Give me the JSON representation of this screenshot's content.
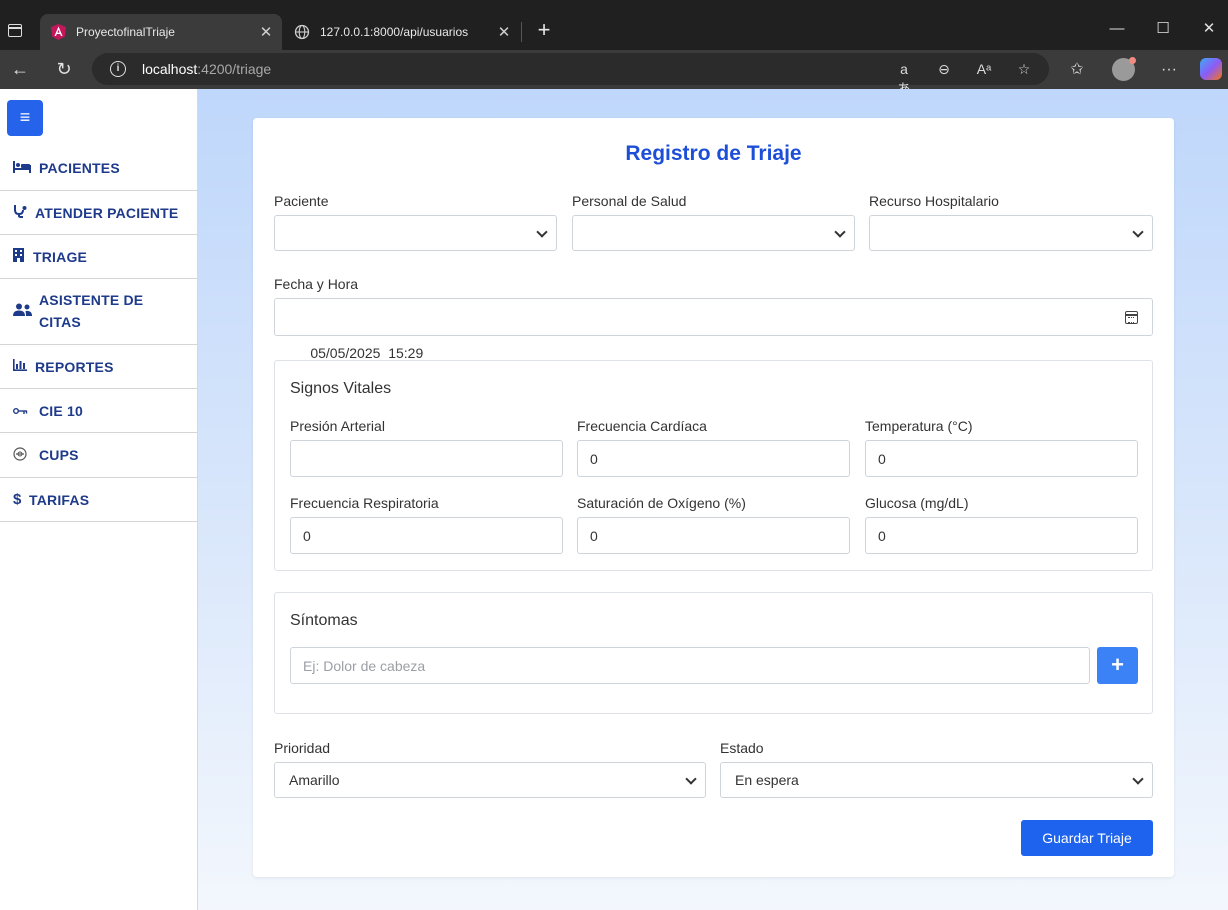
{
  "browser": {
    "tabs": [
      {
        "title": "ProyectofinalTriaje",
        "active": true
      },
      {
        "title": "127.0.0.1:8000/api/usuarios",
        "active": false
      }
    ],
    "url_host": "localhost",
    "url_rest": ":4200/triage"
  },
  "sidebar": {
    "items": [
      {
        "label": "PACIENTES",
        "icon": "bed-icon"
      },
      {
        "label": "ATENDER PACIENTE",
        "icon": "stethoscope-icon"
      },
      {
        "label": "TRIAGE",
        "icon": "hospital-icon"
      },
      {
        "label": "ASISTENTE DE CITAS",
        "icon": "users-icon"
      },
      {
        "label": "REPORTES",
        "icon": "chart-icon"
      },
      {
        "label": "CIE 10",
        "icon": "key-icon"
      },
      {
        "label": "CUPS",
        "icon": "pill-icon"
      },
      {
        "label": "TARIFAS",
        "icon": "dollar-icon"
      }
    ]
  },
  "form": {
    "title": "Registro de Triaje",
    "paciente_label": "Paciente",
    "personal_label": "Personal de Salud",
    "recurso_label": "Recurso Hospitalario",
    "fecha_label": "Fecha y Hora",
    "fecha_value": "05/05/2025  15:29",
    "signos": {
      "title": "Signos Vitales",
      "presion_label": "Presión Arterial",
      "presion_value": "",
      "fc_label": "Frecuencia Cardíaca",
      "fc_value": "0",
      "temp_label": "Temperatura (°C)",
      "temp_value": "0",
      "fr_label": "Frecuencia Respiratoria",
      "fr_value": "0",
      "sat_label": "Saturación de Oxígeno (%)",
      "sat_value": "0",
      "glucosa_label": "Glucosa (mg/dL)",
      "glucosa_value": "0"
    },
    "sintomas": {
      "title": "Síntomas",
      "placeholder": "Ej: Dolor de cabeza"
    },
    "prioridad_label": "Prioridad",
    "prioridad_value": "Amarillo",
    "estado_label": "Estado",
    "estado_value": "En espera",
    "save_label": "Guardar Triaje"
  }
}
